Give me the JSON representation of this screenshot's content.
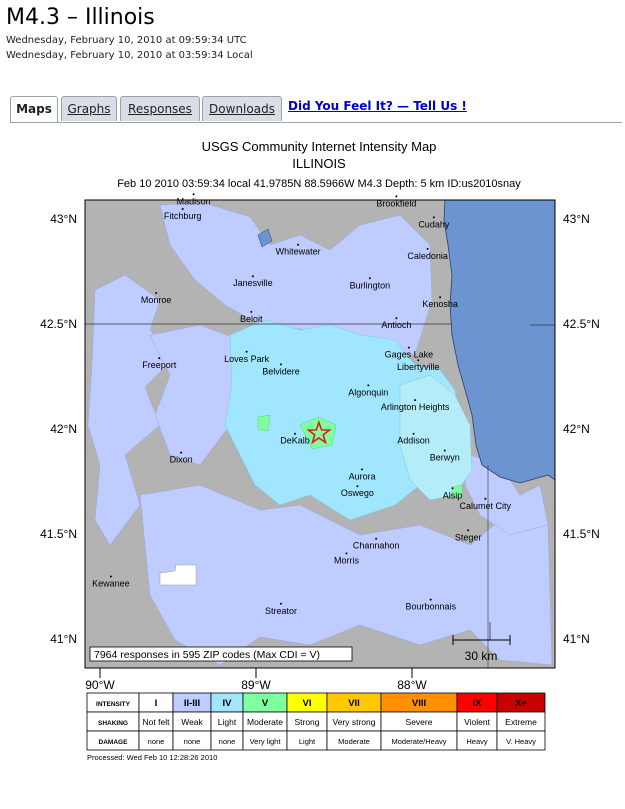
{
  "header": {
    "title": "M4.3 – Illinois",
    "utc_time": "Wednesday, February 10, 2010 at 09:59:34 UTC",
    "local_time": "Wednesday, February 10, 2010 at 03:59:34 Local"
  },
  "tabs": [
    {
      "label": "Maps",
      "active": true
    },
    {
      "label": "Graphs",
      "active": false
    },
    {
      "label": "Responses",
      "active": false
    },
    {
      "label": "Downloads",
      "active": false
    }
  ],
  "dyfi_link": "Did You Feel It? — Tell Us !",
  "map": {
    "title": "USGS Community Internet Intensity Map",
    "region": "ILLINOIS",
    "event_line": "Feb 10 2010 03:59:34 local 41.9785N 88.5966W M4.3 Depth: 5 km ID:us2010snay",
    "lat_labels": [
      "43°N",
      "42.5°N",
      "42°N",
      "41.5°N",
      "41°N"
    ],
    "lon_labels": [
      "90°W",
      "89°W",
      "88°W"
    ],
    "responses_note": "7964 responses in 595 ZIP codes (Max CDI = V)",
    "scale_label": "30 km",
    "processed": "Processed: Wed Feb 10 12:28:26 2010",
    "colors": {
      "land": "#b3b3b3",
      "lake": "#6b94d0",
      "epicenter": "#e01818"
    },
    "cities": [
      {
        "name": "Madison",
        "lon": -89.4,
        "lat": 43.07
      },
      {
        "name": "Fitchburg",
        "lon": -89.47,
        "lat": 43.0
      },
      {
        "name": "Whitewater",
        "lon": -88.73,
        "lat": 42.83
      },
      {
        "name": "Brookfield",
        "lon": -88.1,
        "lat": 43.06
      },
      {
        "name": "Cudahy",
        "lon": -87.86,
        "lat": 42.96
      },
      {
        "name": "Caledonia",
        "lon": -87.9,
        "lat": 42.81
      },
      {
        "name": "Janesville",
        "lon": -89.02,
        "lat": 42.68
      },
      {
        "name": "Burlington",
        "lon": -88.27,
        "lat": 42.67
      },
      {
        "name": "Monroe",
        "lon": -89.64,
        "lat": 42.6
      },
      {
        "name": "Kenosha",
        "lon": -87.82,
        "lat": 42.58
      },
      {
        "name": "Beloit",
        "lon": -89.03,
        "lat": 42.51
      },
      {
        "name": "Antioch",
        "lon": -88.1,
        "lat": 42.48
      },
      {
        "name": "Loves Park",
        "lon": -89.06,
        "lat": 42.32
      },
      {
        "name": "Gages Lake",
        "lon": -88.02,
        "lat": 42.34
      },
      {
        "name": "Freeport",
        "lon": -89.62,
        "lat": 42.29
      },
      {
        "name": "Belvidere",
        "lon": -88.84,
        "lat": 42.26
      },
      {
        "name": "Libertyville",
        "lon": -87.96,
        "lat": 42.28
      },
      {
        "name": "Algonquin",
        "lon": -88.28,
        "lat": 42.16
      },
      {
        "name": "Arlington Heights",
        "lon": -87.98,
        "lat": 42.09
      },
      {
        "name": "DeKalb",
        "lon": -88.75,
        "lat": 41.93
      },
      {
        "name": "Addison",
        "lon": -87.99,
        "lat": 41.93
      },
      {
        "name": "Dixon",
        "lon": -89.48,
        "lat": 41.84
      },
      {
        "name": "Berwyn",
        "lon": -87.79,
        "lat": 41.85
      },
      {
        "name": "Aurora",
        "lon": -88.32,
        "lat": 41.76
      },
      {
        "name": "Oswego",
        "lon": -88.35,
        "lat": 41.68
      },
      {
        "name": "Alsip",
        "lon": -87.74,
        "lat": 41.67
      },
      {
        "name": "Calumet City",
        "lon": -87.53,
        "lat": 41.62
      },
      {
        "name": "Channahon",
        "lon": -88.23,
        "lat": 41.43
      },
      {
        "name": "Steger",
        "lon": -87.64,
        "lat": 41.47
      },
      {
        "name": "Morris",
        "lon": -88.42,
        "lat": 41.36
      },
      {
        "name": "Kewanee",
        "lon": -89.93,
        "lat": 41.25
      },
      {
        "name": "Bourbonnais",
        "lon": -87.88,
        "lat": 41.14
      },
      {
        "name": "Streator",
        "lon": -88.84,
        "lat": 41.12
      }
    ]
  },
  "legend": {
    "row_labels": [
      "INTENSITY",
      "SHAKING",
      "DAMAGE"
    ],
    "intensity": [
      "I",
      "II-III",
      "IV",
      "V",
      "VI",
      "VII",
      "VIII",
      "IX",
      "X+"
    ],
    "colors": [
      "#ffffff",
      "#bfccff",
      "#a0e6ff",
      "#80ffa0",
      "#ffff00",
      "#ffc800",
      "#ff9100",
      "#ff0000",
      "#c80000"
    ],
    "shaking": [
      "Not felt",
      "Weak",
      "Light",
      "Moderate",
      "Strong",
      "Very strong",
      "Severe",
      "Violent",
      "Extreme"
    ],
    "damage": [
      "none",
      "none",
      "none",
      "Very light",
      "Light",
      "Moderate",
      "Moderate/Heavy",
      "Heavy",
      "V. Heavy"
    ]
  }
}
